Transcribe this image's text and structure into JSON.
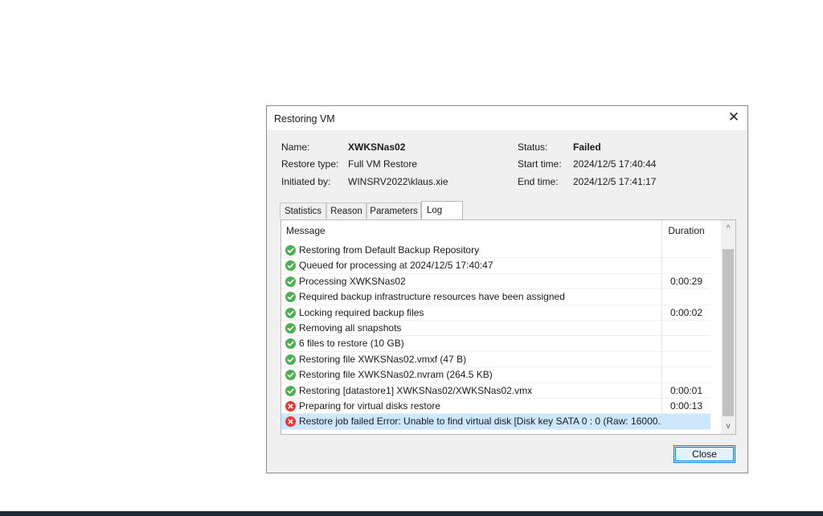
{
  "dialog": {
    "title": "Restoring VM",
    "close_glyph": "✕",
    "info": {
      "name_label": "Name:",
      "name_value": "XWKSNas02",
      "restore_type_label": "Restore type:",
      "restore_type_value": "Full VM Restore",
      "initiated_by_label": "Initiated by:",
      "initiated_by_value": "WINSRV2022\\klaus.xie",
      "status_label": "Status:",
      "status_value": "Failed",
      "start_time_label": "Start time:",
      "start_time_value": "2024/12/5 17:40:44",
      "end_time_label": "End time:",
      "end_time_value": "2024/12/5 17:41:17"
    },
    "tabs": [
      {
        "label": "Statistics",
        "active": false
      },
      {
        "label": "Reason",
        "active": false
      },
      {
        "label": "Parameters",
        "active": false
      },
      {
        "label": "Log",
        "active": true
      }
    ],
    "log": {
      "columns": {
        "message": "Message",
        "duration": "Duration"
      },
      "rows": [
        {
          "status": "success",
          "message": "Restoring from Default Backup Repository",
          "duration": ""
        },
        {
          "status": "success",
          "message": "Queued for processing at 2024/12/5 17:40:47",
          "duration": ""
        },
        {
          "status": "success",
          "message": "Processing XWKSNas02",
          "duration": "0:00:29"
        },
        {
          "status": "success",
          "message": "Required backup infrastructure resources have been assigned",
          "duration": ""
        },
        {
          "status": "success",
          "message": "Locking required backup files",
          "duration": "0:00:02"
        },
        {
          "status": "success",
          "message": "Removing all snapshots",
          "duration": ""
        },
        {
          "status": "success",
          "message": "6 files to restore (10 GB)",
          "duration": ""
        },
        {
          "status": "success",
          "message": "Restoring file XWKSNas02.vmxf (47 B)",
          "duration": ""
        },
        {
          "status": "success",
          "message": "Restoring file XWKSNas02.nvram (264.5 KB)",
          "duration": ""
        },
        {
          "status": "success",
          "message": "Restoring [datastore1] XWKSNas02/XWKSNas02.vmx",
          "duration": "0:00:01"
        },
        {
          "status": "error",
          "message": "Preparing for virtual disks restore",
          "duration": "0:00:13"
        },
        {
          "status": "error",
          "message": "Restore job failed Error: Unable to find virtual disk [Disk key SATA 0 : 0 (Raw: 16000...",
          "duration": "",
          "selected": true
        }
      ]
    },
    "scroll_up_glyph": "^",
    "scroll_down_glyph": "v",
    "close_button_label": "Close"
  },
  "colors": {
    "success": "#4caf50",
    "error": "#e53935",
    "selection": "#cce8ff",
    "accent": "#0078d7"
  }
}
